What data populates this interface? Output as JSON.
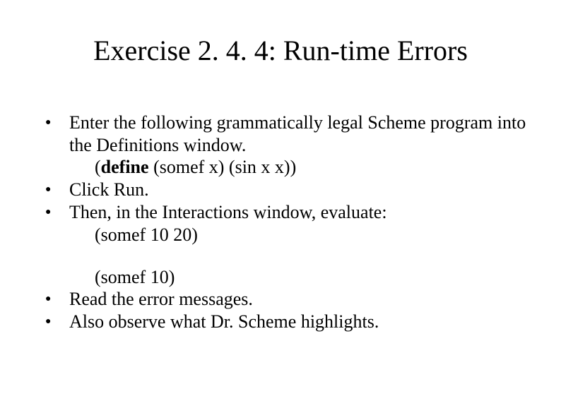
{
  "title": "Exercise 2. 4. 4: Run-time Errors",
  "bullets": {
    "b1": {
      "text": "Enter the following grammatically legal Scheme program into the Definitions window.",
      "code_prefix": "(",
      "code_bold": "define",
      "code_rest": " (somef x) (sin x x))"
    },
    "b2": {
      "text": "Click Run."
    },
    "b3": {
      "text": "Then, in the Interactions window, evaluate:",
      "code1": "(somef 10 20)",
      "code2": "(somef 10)"
    },
    "b4": {
      "text": "Read the error messages."
    },
    "b5": {
      "text": "Also observe what Dr. Scheme highlights."
    }
  },
  "bullet_char": "●"
}
